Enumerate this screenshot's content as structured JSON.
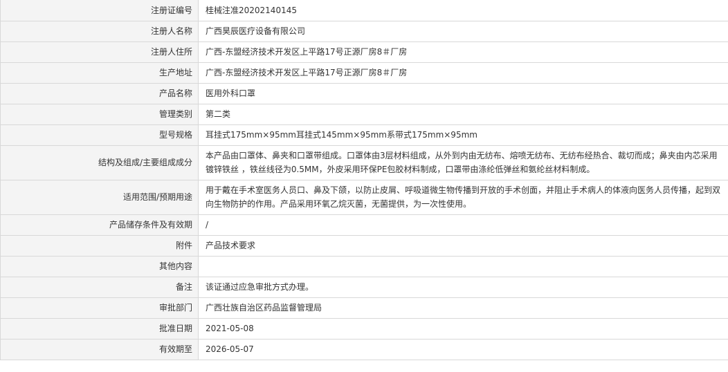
{
  "rows": [
    {
      "label": "注册证编号",
      "value": "桂械注准20202140145"
    },
    {
      "label": "注册人名称",
      "value": "广西昊辰医疗设备有限公司"
    },
    {
      "label": "注册人住所",
      "value": "广西-东盟经济技术开发区上平路17号正源厂房8＃厂房"
    },
    {
      "label": "生产地址",
      "value": "广西-东盟经济技术开发区上平路17号正源厂房8＃厂房"
    },
    {
      "label": "产品名称",
      "value": "医用外科口罩"
    },
    {
      "label": "管理类别",
      "value": "第二类"
    },
    {
      "label": "型号规格",
      "value": "耳挂式175mm×95mm耳挂式145mm×95mm系带式175mm×95mm"
    },
    {
      "label": "结构及组成/主要组成成分",
      "value": "本产品由口罩体、鼻夹和口罩带组成。口罩体由3层材料组成，从外到内由无纺布、熔喷无纺布、无纺布经热合、裁切而成；鼻夹由内芯采用镀锌铁丝 ，铁丝线径为0.5MM，外皮采用环保PE包胶材料制成，口罩带由涤纶低弹丝和氨纶丝材料制成。"
    },
    {
      "label": "适用范围/预期用途",
      "value": "用于戴在手术室医务人员口、鼻及下颌，以防止皮屑、呼吸道微生物传播到开放的手术创面，并阻止手术病人的体液向医务人员传播，起到双向生物防护的作用。产品采用环氧乙烷灭菌，无菌提供，为一次性使用。"
    },
    {
      "label": "产品储存条件及有效期",
      "value": "/"
    },
    {
      "label": "附件",
      "value": "产品技术要求"
    },
    {
      "label": "其他内容",
      "value": ""
    },
    {
      "label": "备注",
      "value": "该证通过应急审批方式办理。"
    },
    {
      "label": "审批部门",
      "value": "广西壮族自治区药品监督管理局"
    },
    {
      "label": "批准日期",
      "value": "2021-05-08"
    },
    {
      "label": "有效期至",
      "value": "2026-05-07"
    }
  ]
}
